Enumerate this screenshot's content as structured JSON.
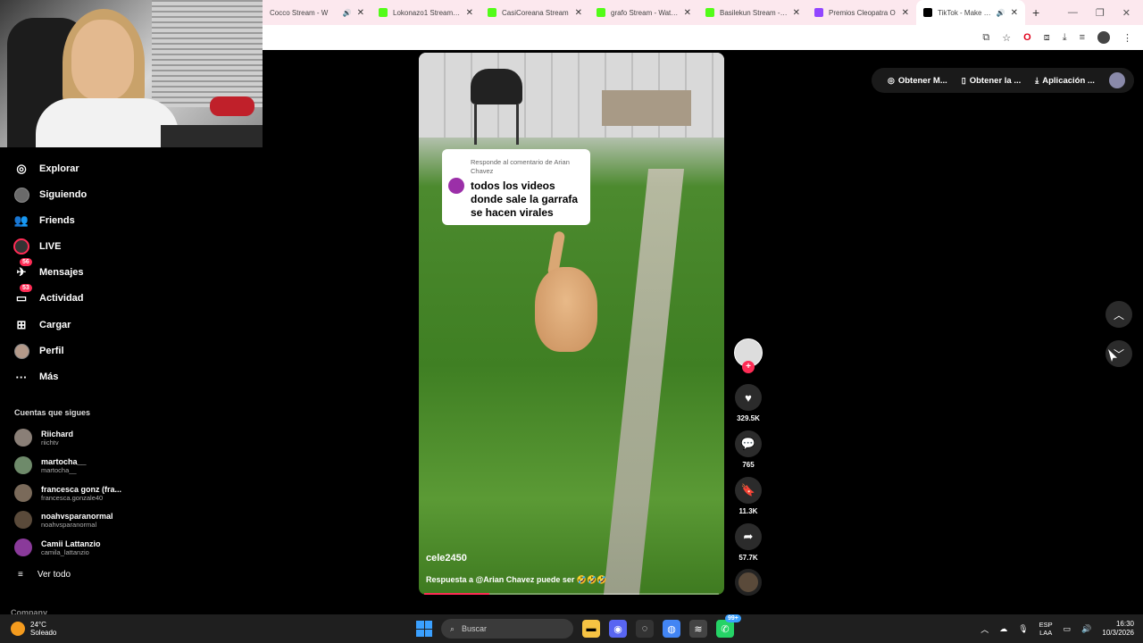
{
  "browser": {
    "tabs": [
      {
        "label": "Cocco Stream - W",
        "icon": "kick",
        "speaker": true
      },
      {
        "label": "Lokonazo1 Stream - K",
        "icon": "kick",
        "speaker": false
      },
      {
        "label": "CasiCoreana Stream",
        "icon": "kick",
        "speaker": false
      },
      {
        "label": "grafo Stream - Watch",
        "icon": "kick",
        "speaker": false
      },
      {
        "label": "Basilekun Stream - W",
        "icon": "kick",
        "speaker": false
      },
      {
        "label": "Premios Cleopatra O",
        "icon": "twitch",
        "speaker": false
      },
      {
        "label": "TikTok - Make Yo",
        "icon": "tiktok",
        "speaker": true,
        "active": true
      }
    ],
    "new_tab": "+",
    "window_controls": [
      "—",
      "❐",
      "✕"
    ]
  },
  "sidebar": {
    "nav": [
      {
        "label": "Explorar",
        "icon": "compass-icon"
      },
      {
        "label": "Siguiendo",
        "icon": "avatar-icon"
      },
      {
        "label": "Friends",
        "icon": "people-icon"
      },
      {
        "label": "LIVE",
        "icon": "live-icon"
      },
      {
        "label": "Mensajes",
        "icon": "messages-icon",
        "badge": "56"
      },
      {
        "label": "Actividad",
        "icon": "activity-icon",
        "badge": "53"
      },
      {
        "label": "Cargar",
        "icon": "upload-icon"
      },
      {
        "label": "Perfil",
        "icon": "profile-icon"
      },
      {
        "label": "Más",
        "icon": "more-icon"
      }
    ],
    "following_title": "Cuentas que sigues",
    "following": [
      {
        "name": "Riichard",
        "handle": "riichtv"
      },
      {
        "name": "martocha__",
        "handle": "martocha__"
      },
      {
        "name": "francesca gonz (fra...",
        "handle": "francesca.gonzale40"
      },
      {
        "name": "noahvsparanormal",
        "handle": "noahvsparanormal"
      },
      {
        "name": "Camii Lattanzio",
        "handle": "camila_lattanzio"
      }
    ],
    "see_all": "Ver todo",
    "company": "Company"
  },
  "topbar": {
    "btn1": "Obtener M...",
    "btn2": "Obtener la ...",
    "btn3": "Aplicación ..."
  },
  "video": {
    "reply_label": "Responde al comentario de Arian Chavez",
    "reply_text": "todos los videos donde sale la garrafa se hacen virales",
    "username": "cele2450",
    "caption": "Respuesta a @Arian Chavez puede ser 🤣🤣🤣",
    "progress_fraction": 0.22
  },
  "actions": {
    "likes": "329.5K",
    "comments": "765",
    "saves": "11.3K",
    "shares": "57.7K"
  },
  "taskbar": {
    "temp": "24°C",
    "weather": "Soleado",
    "search_placeholder": "Buscar",
    "lang_line1": "ESP",
    "lang_line2": "LAA",
    "time": "16:30",
    "date": "10/3/2026",
    "chat_badge": "99+"
  }
}
